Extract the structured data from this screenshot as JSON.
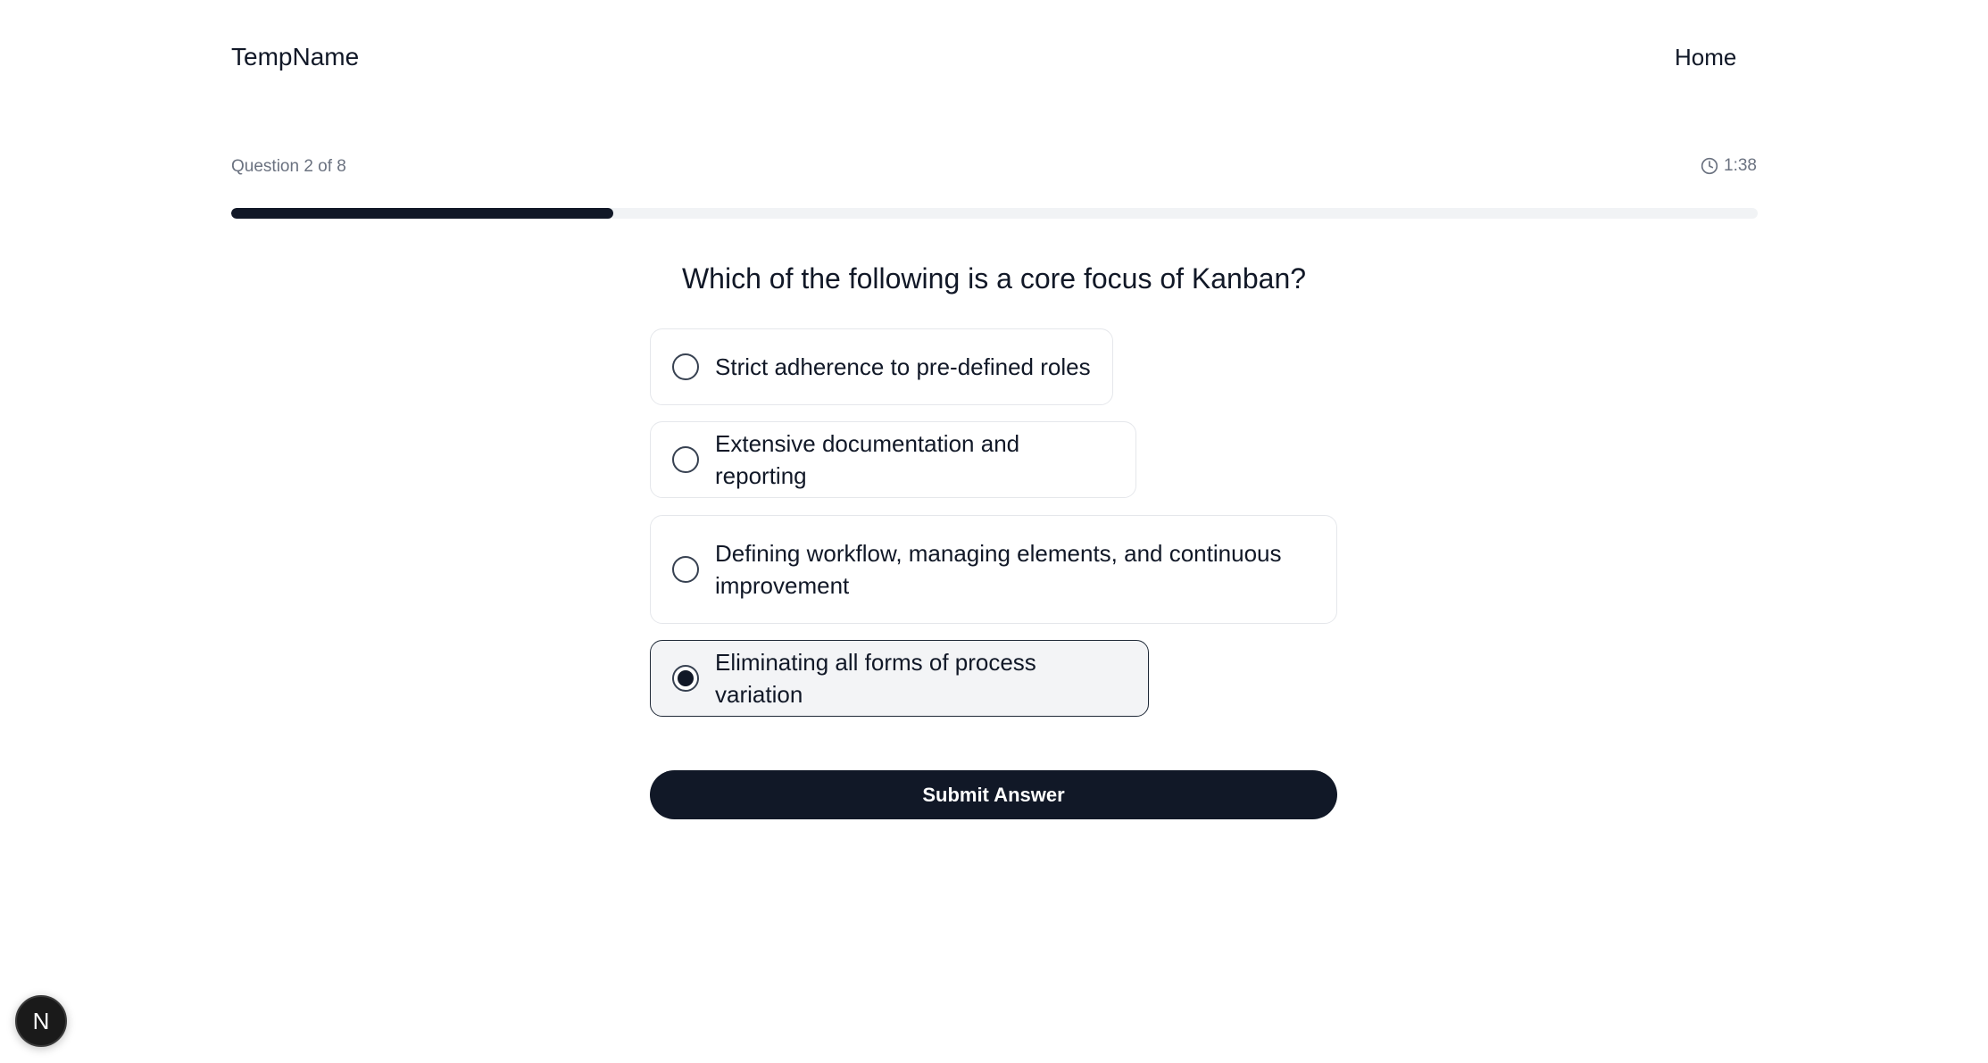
{
  "header": {
    "brand": "TempName",
    "nav_home": "Home"
  },
  "quiz": {
    "counter": "Question 2 of 8",
    "timer": "1:38",
    "progress_fraction": 0.25,
    "question": "Which of the following is a core focus of Kanban?",
    "options": [
      {
        "label": "Strict adherence to pre-defined roles",
        "selected": false
      },
      {
        "label": "Extensive documentation and reporting",
        "selected": false
      },
      {
        "label": "Defining workflow, managing elements, and continuous improvement",
        "selected": false
      },
      {
        "label": "Eliminating all forms of process variation",
        "selected": true
      }
    ],
    "submit_label": "Submit Answer"
  },
  "dev_badge": {
    "letter": "N",
    "icon": "nextjs-logo-icon"
  },
  "colors": {
    "primary": "#111827",
    "muted_text": "#6b7280",
    "track": "#f1f3f5",
    "selected_bg": "#f3f4f6"
  }
}
